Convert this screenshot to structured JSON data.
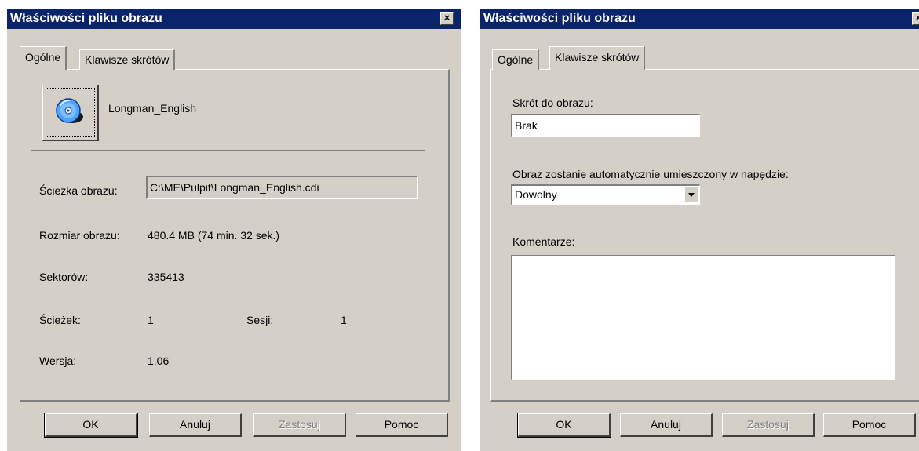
{
  "left_dialog": {
    "title": "Właściwości pliku obrazu",
    "close_glyph": "×",
    "tabs": [
      {
        "label": "Ogólne",
        "active": true
      },
      {
        "label": "Klawisze skrótów",
        "active": false
      }
    ],
    "image_name": "Longman_English",
    "image_icon": "cd-disc-icon",
    "path_label": "Ścieżka obrazu:",
    "path_value": "C:\\ME\\Pulpit\\Longman_English.cdi",
    "size_label": "Rozmiar obrazu:",
    "size_value": "480.4 MB (74 min. 32 sek.)",
    "sectors_label": "Sektorów:",
    "sectors_value": "335413",
    "tracks_label": "Ścieżek:",
    "tracks_value": "1",
    "sessions_label": "Sesji:",
    "sessions_value": "1",
    "version_label": "Wersja:",
    "version_value": "1.06"
  },
  "right_dialog": {
    "title": "Właściwości pliku obrazu",
    "close_glyph": "×",
    "tabs": [
      {
        "label": "Ogólne",
        "active": false
      },
      {
        "label": "Klawisze skrótów",
        "active": true
      }
    ],
    "shortcut_label": "Skrót do obrazu:",
    "shortcut_value": "Brak",
    "automount_label": "Obraz zostanie automatycznie umieszczony w napędzie:",
    "automount_value": "Dowolny",
    "comments_label": "Komentarze:",
    "comments_value": ""
  },
  "buttons": {
    "ok": "OK",
    "cancel": "Anuluj",
    "apply": "Zastosuj",
    "help": "Pomoc"
  },
  "colors": {
    "titlebar": "#0a246a",
    "face": "#d4d0c8"
  }
}
